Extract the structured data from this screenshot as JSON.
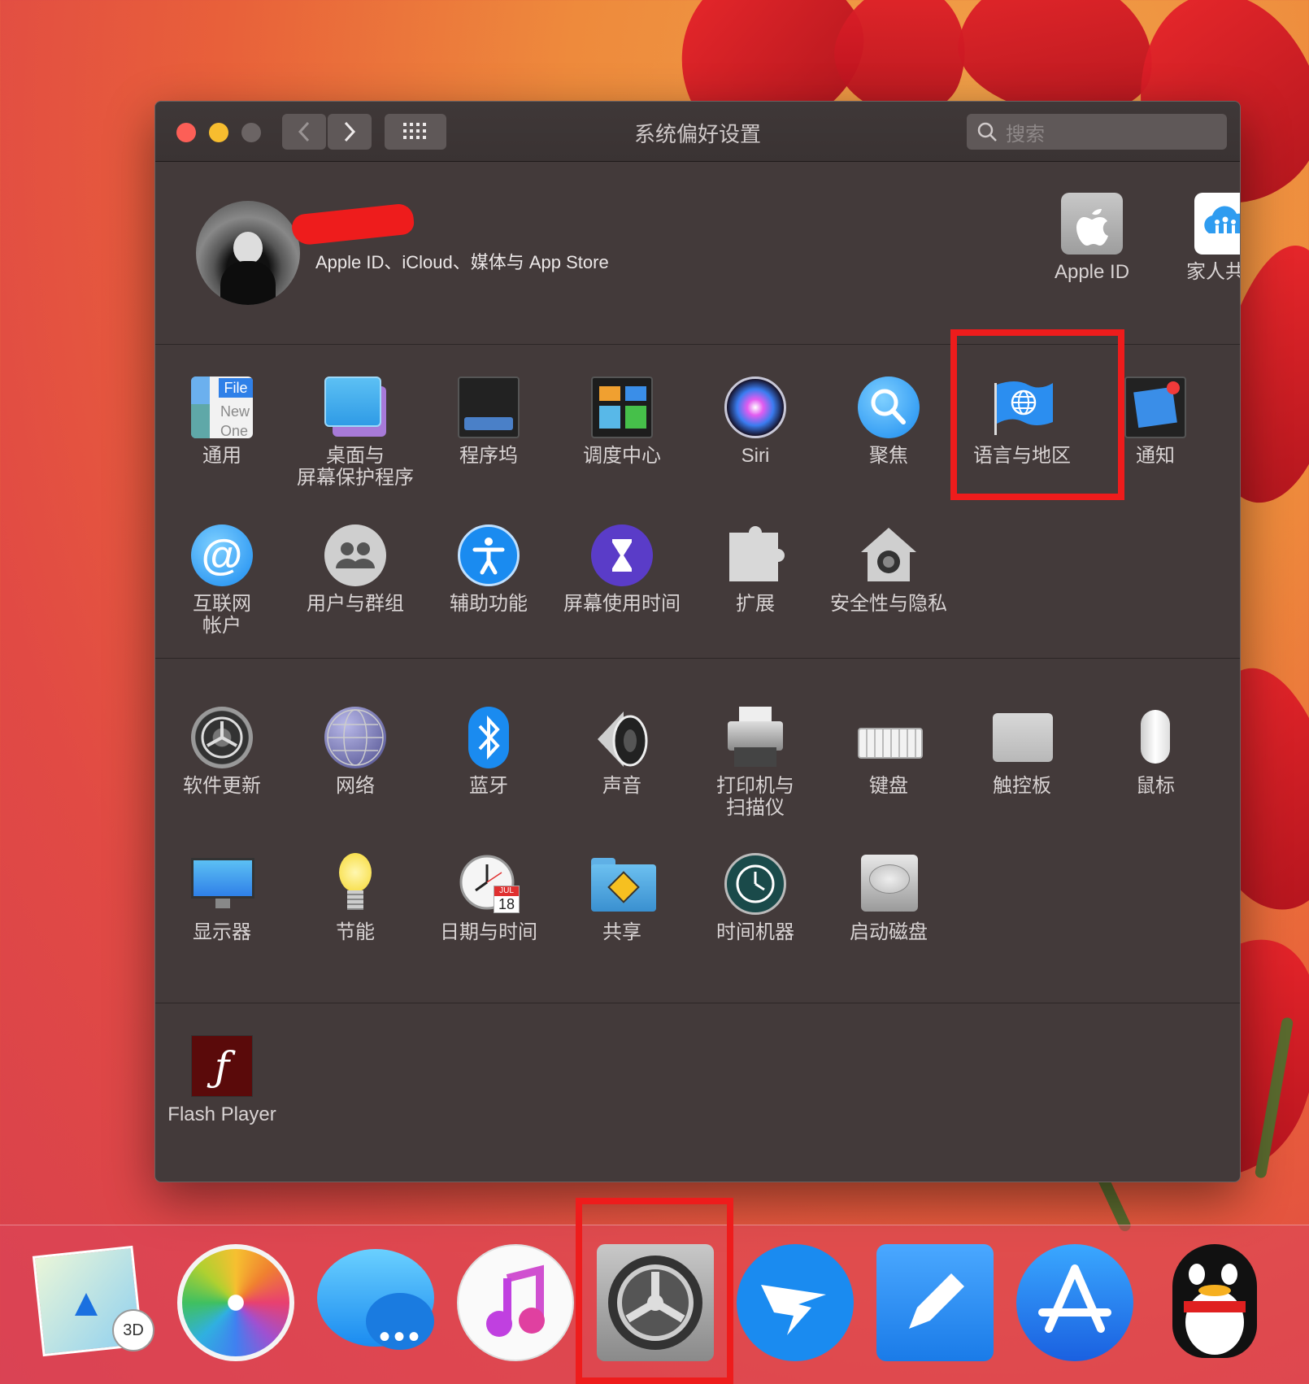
{
  "window": {
    "title": "系统偏好设置",
    "search_placeholder": "搜索"
  },
  "account": {
    "subtitle": "Apple ID、iCloud、媒体与 App Store",
    "apple_id_label": "Apple ID",
    "family_label": "家人共享"
  },
  "row1": [
    {
      "label": "通用",
      "icon": "general-icon",
      "icon_text_top": "File",
      "icon_text_mid": "New",
      "icon_text_bot": "One"
    },
    {
      "label": "桌面与\n屏幕保护程序",
      "icon": "desktop-icon"
    },
    {
      "label": "程序坞",
      "icon": "dock-icon"
    },
    {
      "label": "调度中心",
      "icon": "mission-control-icon"
    },
    {
      "label": "Siri",
      "icon": "siri-icon"
    },
    {
      "label": "聚焦",
      "icon": "spotlight-icon"
    },
    {
      "label": "语言与地区",
      "icon": "language-region-icon"
    },
    {
      "label": "通知",
      "icon": "notifications-icon"
    }
  ],
  "row2": [
    {
      "label": "互联网\n帐户",
      "icon": "internet-accounts-icon"
    },
    {
      "label": "用户与群组",
      "icon": "users-groups-icon"
    },
    {
      "label": "辅助功能",
      "icon": "accessibility-icon"
    },
    {
      "label": "屏幕使用时间",
      "icon": "screen-time-icon"
    },
    {
      "label": "扩展",
      "icon": "extensions-icon"
    },
    {
      "label": "安全性与隐私",
      "icon": "security-privacy-icon"
    }
  ],
  "row3": [
    {
      "label": "软件更新",
      "icon": "software-update-icon"
    },
    {
      "label": "网络",
      "icon": "network-icon"
    },
    {
      "label": "蓝牙",
      "icon": "bluetooth-icon"
    },
    {
      "label": "声音",
      "icon": "sound-icon"
    },
    {
      "label": "打印机与\n扫描仪",
      "icon": "printer-icon"
    },
    {
      "label": "键盘",
      "icon": "keyboard-icon"
    },
    {
      "label": "触控板",
      "icon": "trackpad-icon"
    },
    {
      "label": "鼠标",
      "icon": "mouse-icon"
    }
  ],
  "row4": [
    {
      "label": "显示器",
      "icon": "display-icon"
    },
    {
      "label": "节能",
      "icon": "energy-saver-icon"
    },
    {
      "label": "日期与时间",
      "icon": "date-time-icon",
      "icon_text_month": "JUL",
      "icon_text_day": "18"
    },
    {
      "label": "共享",
      "icon": "sharing-icon"
    },
    {
      "label": "时间机器",
      "icon": "time-machine-icon"
    },
    {
      "label": "启动磁盘",
      "icon": "startup-disk-icon"
    }
  ],
  "other": [
    {
      "label": "Flash Player",
      "icon": "flash-player-icon"
    }
  ],
  "dock": {
    "apps": [
      "maps-icon",
      "photos-icon",
      "messages-icon",
      "music-icon",
      "system-preferences-icon",
      "dingtalk-icon",
      "pages-icon",
      "app-store-icon",
      "qq-icon"
    ],
    "maps_badge": "3D"
  },
  "colors": {
    "highlight": "#ee1c1c",
    "window_bg": "#433a3a",
    "text": "#d8d3d3"
  }
}
